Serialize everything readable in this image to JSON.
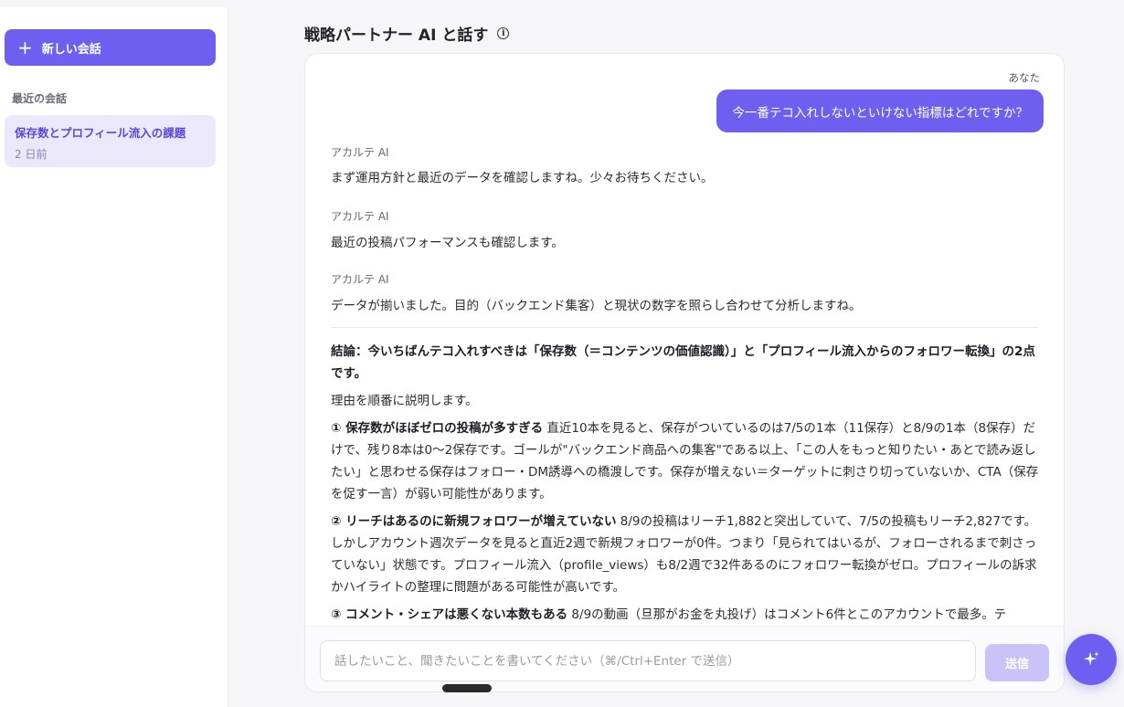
{
  "sidebar": {
    "new_chat_label": "新しい会話",
    "recent_label": "最近の会話",
    "history": [
      {
        "title": "保存数とプロフィール流入の課題",
        "time": "2 日前"
      }
    ]
  },
  "header": {
    "title": "戦略パートナー AI と話す",
    "info_icon": "i"
  },
  "chat": {
    "user_label": "あなた",
    "user_message": "今一番テコ入れしないといけない指標はどれですか？",
    "ai_name": "アカルテ AI",
    "ai_messages": [
      "まず運用方針と最近のデータを確認しますね。少々お待ちください。",
      "最近の投稿パフォーマンスも確認します。",
      "データが揃いました。目的（バックエンド集客）と現状の数字を照らし合わせて分析しますね。"
    ],
    "answer": {
      "conclusion": "結論：今いちばんテコ入れすべきは「保存数（＝コンテンツの価値認識）」と「プロフィール流入からのフォロワー転換」の2点です。",
      "intro": "理由を順番に説明します。",
      "points": [
        {
          "heading": "① 保存数がほぼゼロの投稿が多すぎる",
          "body": " 直近10本を見ると、保存がついているのは7/5の1本（11保存）と8/9の1本（8保存）だけで、残り8本は0〜2保存です。ゴールが\"バックエンド商品への集客\"である以上、「この人をもっと知りたい・あとで読み返したい」と思わせる保存はフォロー・DM誘導への橋渡しです。保存が増えない＝ターゲットに刺さり切っていないか、CTA（保存を促す一言）が弱い可能性があります。"
        },
        {
          "heading": "② リーチはあるのに新規フォロワーが増えていない",
          "body": " 8/9の投稿はリーチ1,882と突出していて、7/5の投稿もリーチ2,827です。しかしアカウント週次データを見ると直近2週で新規フォロワーが0件。つまり「見られてはいるが、フォローされるまで刺さっていない」状態です。プロフィール流入（profile_views）も8/2週で32件あるのにフォロワー転換がゼロ。プロフィールの訴求かハイライトの整理に問題がある可能性が高いです。"
        },
        {
          "heading": "③ コメント・シェアは悪くない本数もある",
          "body": " 8/9の動画（旦那がお金を丸投げ）はコメント6件とこのアカウントで最多。テ"
        }
      ]
    }
  },
  "composer": {
    "placeholder": "話したいこと、聞きたいことを書いてください（⌘/Ctrl+Enter で送信）",
    "send_label": "送信"
  },
  "colors": {
    "accent": "#6f5ff0",
    "accent_light": "#ebe8fb",
    "send_disabled": "#c9c3f7"
  },
  "icons": {
    "new_chat": "plus-icon",
    "fab": "sparkle-icon",
    "info": "info-icon"
  }
}
